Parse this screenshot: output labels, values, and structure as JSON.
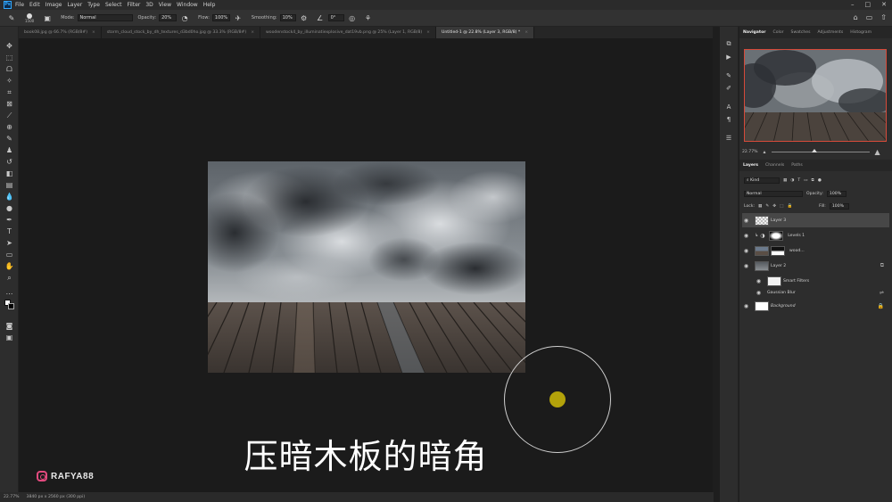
{
  "app": {
    "logo": "Ps",
    "menu": [
      "File",
      "Edit",
      "Image",
      "Layer",
      "Type",
      "Select",
      "Filter",
      "3D",
      "View",
      "Window",
      "Help"
    ]
  },
  "options": {
    "brush_size": "1500",
    "mode_label": "Mode:",
    "mode_value": "Normal",
    "opacity_label": "Opacity:",
    "opacity_value": "20%",
    "flow_label": "Flow:",
    "flow_value": "100%",
    "smoothing_label": "Smoothing:",
    "smoothing_value": "10%",
    "angle_value": "0°"
  },
  "tabs": [
    {
      "label": "book08.jpg @ 66.7% (RGB/8#)",
      "active": false
    },
    {
      "label": "storm_cloud_stock_by_dh_textures_d3bd0ho.jpg @ 33.3% (RGB/8#)",
      "active": false
    },
    {
      "label": "woodenstock4_by_illuminatiexplosive_dat19vb.png @ 25% (Layer 1, RGB/8)",
      "active": false
    },
    {
      "label": "Untitled-1 @ 22.8% (Layer 3, RGB/8) *",
      "active": true
    }
  ],
  "caption": "压暗木板的暗角",
  "watermark": "RAFYA88",
  "status": {
    "zoom": "22.77%",
    "doc_size": "3840 px x 2560 px (300 ppi)"
  },
  "navigator": {
    "tabs": [
      "Navigator",
      "Color",
      "Swatches",
      "Adjustments",
      "Histogram"
    ],
    "zoom": "22.77%"
  },
  "layers_panel": {
    "tabs": [
      "Layers",
      "Channels",
      "Paths"
    ],
    "kind_label": "Kind",
    "blend_mode": "Normal",
    "opacity_label": "Opacity:",
    "opacity_value": "100%",
    "lock_label": "Lock:",
    "fill_label": "Fill:",
    "fill_value": "100%",
    "layers": [
      {
        "name": "Layer 3",
        "selected": true
      },
      {
        "name": "Levels 1",
        "selected": false
      },
      {
        "name": "wood...",
        "selected": false
      },
      {
        "name": "Layer 2",
        "selected": false
      },
      {
        "name": "Smart Filters",
        "selected": false
      },
      {
        "name": "Gaussian Blur",
        "selected": false
      },
      {
        "name": "Background",
        "selected": false
      }
    ]
  },
  "colors": {
    "accent_dot": "#b3a20a",
    "navigator_frame": "#d64a3a",
    "instagram": "#e24a7e"
  }
}
